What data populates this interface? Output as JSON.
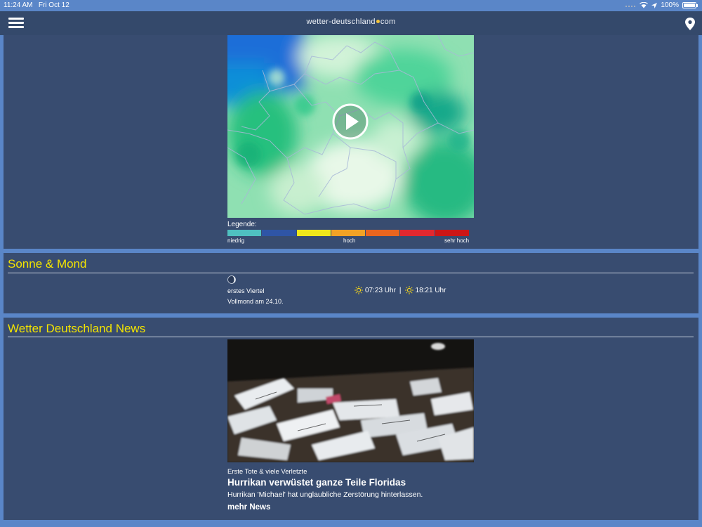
{
  "status_bar": {
    "time": "11:24 AM",
    "date": "Fri Oct 12",
    "battery": "100%"
  },
  "header": {
    "brand_left": "wetter-deutschland",
    "brand_right": "com",
    "menu_icon": "hamburger-icon",
    "location_icon": "location-pin-icon"
  },
  "radar": {
    "play_icon": "play-icon",
    "legend_label": "Legende:",
    "legend_colors": [
      "#4fc0c0",
      "#2f55a6",
      "#f0e81a",
      "#f2a225",
      "#e9651f",
      "#e3282f",
      "#cc1616"
    ],
    "legend_ticks": {
      "low": "niedrig",
      "mid": "hoch",
      "high": "sehr hoch"
    }
  },
  "sun_moon": {
    "title": "Sonne & Mond",
    "moon_phase": "erstes Viertel",
    "full_moon": "Vollmond am 24.10.",
    "sunrise": "07:23 Uhr",
    "separator": "|",
    "sunset": "18:21 Uhr"
  },
  "news": {
    "title": "Wetter Deutschland News",
    "kicker": "Erste Tote & viele Verletzte",
    "headline": "Hurrikan verwüstet ganze Teile Floridas",
    "teaser": "Hurrikan 'Michael' hat unglaubliche Zerstörung hinterlassen.",
    "more_link": "mehr News"
  },
  "colors": {
    "accent_title": "#f3e400",
    "panel": "#384c70",
    "navbar": "#34496b"
  }
}
